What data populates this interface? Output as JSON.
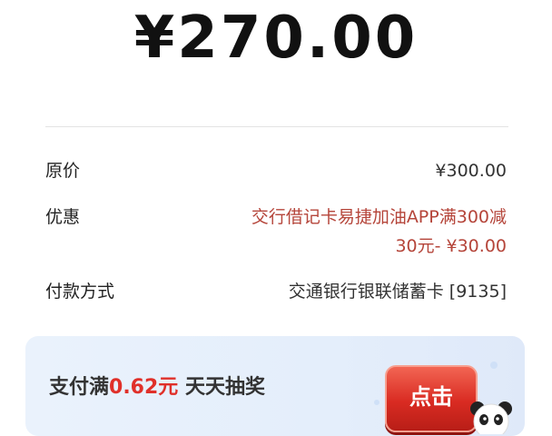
{
  "payment": {
    "amount": "¥270.00"
  },
  "details": {
    "original_price_label": "原价",
    "original_price_value": "¥300.00",
    "discount_label": "优惠",
    "discount_line1": "交行借记卡易捷加油APP满300减",
    "discount_line2": "30元- ¥30.00",
    "method_label": "付款方式",
    "method_value": "交通银行银联储蓄卡 [9135]"
  },
  "banner": {
    "prefix": "支付满",
    "highlight": "0.62元",
    "suffix": " 天天抽奖",
    "button_label": "点击"
  },
  "colors": {
    "discount": "#b5453a",
    "highlight": "#e0302a",
    "button": "#d92b22"
  }
}
